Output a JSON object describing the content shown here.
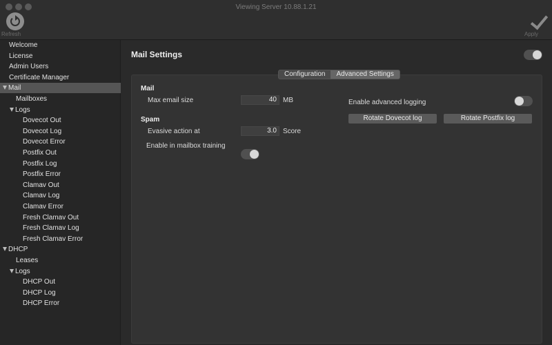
{
  "window": {
    "title": "Viewing Server 10.88.1.21"
  },
  "toolbar": {
    "refresh_label": "Refresh",
    "apply_label": "Apply"
  },
  "sidebar": {
    "items": [
      {
        "label": "Welcome"
      },
      {
        "label": "License"
      },
      {
        "label": "Admin Users"
      },
      {
        "label": "Certificate Manager"
      },
      {
        "label": "Mail",
        "expanded": true,
        "selected": true
      },
      {
        "label": "Mailboxes"
      },
      {
        "label": "Logs",
        "expanded": true
      },
      {
        "label": "Dovecot Out"
      },
      {
        "label": "Dovecot Log"
      },
      {
        "label": "Dovecot Error"
      },
      {
        "label": "Postfix Out"
      },
      {
        "label": "Postfix Log"
      },
      {
        "label": "Postfix Error"
      },
      {
        "label": "Clamav Out"
      },
      {
        "label": "Clamav Log"
      },
      {
        "label": "Clamav Error"
      },
      {
        "label": "Fresh Clamav Out"
      },
      {
        "label": "Fresh Clamav Log"
      },
      {
        "label": "Fresh Clamav Error"
      },
      {
        "label": "DHCP",
        "expanded": true
      },
      {
        "label": "Leases"
      },
      {
        "label": "Logs",
        "expanded": true
      },
      {
        "label": "DHCP Out"
      },
      {
        "label": "DHCP Log"
      },
      {
        "label": "DHCP Error"
      }
    ]
  },
  "main": {
    "title": "Mail Settings",
    "enabled": true,
    "tabs": [
      {
        "label": "Configuration",
        "active": false
      },
      {
        "label": "Advanced Settings",
        "active": true
      }
    ],
    "mail": {
      "heading": "Mail",
      "max_email_size_label": "Max email size",
      "max_email_size_value": "40",
      "max_email_size_unit": "MB"
    },
    "spam": {
      "heading": "Spam",
      "evasive_action_label": "Evasive action at",
      "evasive_action_value": "3.0",
      "evasive_action_unit": "Score",
      "mailbox_training_label": "Enable in mailbox training",
      "mailbox_training_enabled": true
    },
    "advanced": {
      "logging_label": "Enable advanced logging",
      "logging_enabled": false,
      "rotate_dovecot_label": "Rotate Dovecot log",
      "rotate_postfix_label": "Rotate Postfix log"
    }
  }
}
